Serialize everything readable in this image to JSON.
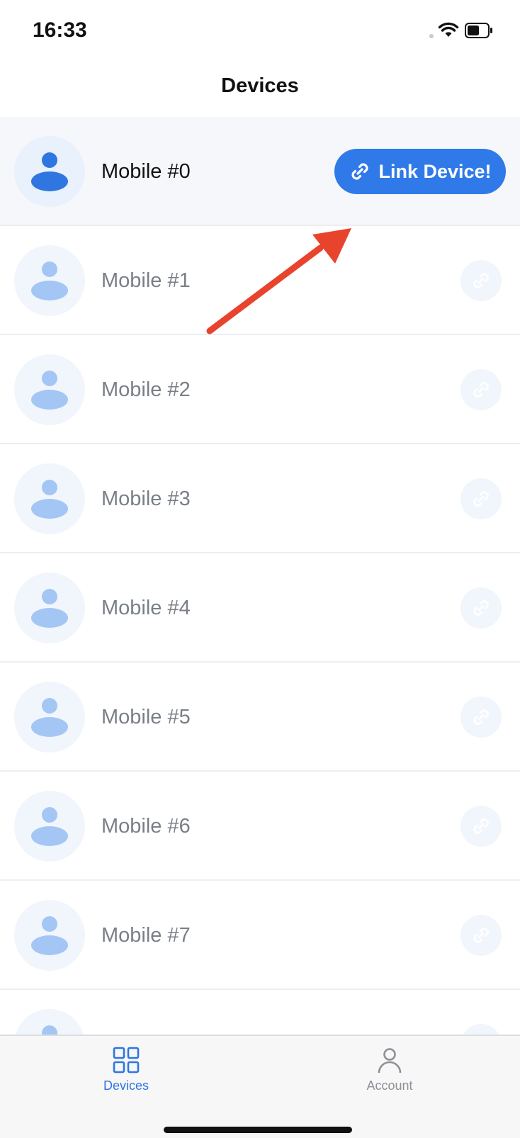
{
  "status_bar": {
    "time": "16:33",
    "icons": [
      "signal-dot-icon",
      "wifi-icon",
      "battery-icon"
    ]
  },
  "nav": {
    "title": "Devices"
  },
  "devices": [
    {
      "label": "Mobile #0",
      "selected": true,
      "action_label": "Link Device!"
    },
    {
      "label": "Mobile #1",
      "selected": false
    },
    {
      "label": "Mobile #2",
      "selected": false
    },
    {
      "label": "Mobile #3",
      "selected": false
    },
    {
      "label": "Mobile #4",
      "selected": false
    },
    {
      "label": "Mobile #5",
      "selected": false
    },
    {
      "label": "Mobile #6",
      "selected": false
    },
    {
      "label": "Mobile #7",
      "selected": false
    },
    {
      "label": "",
      "selected": false
    }
  ],
  "tab_bar": {
    "tabs": [
      {
        "label": "Devices",
        "icon": "grid-icon",
        "active": true
      },
      {
        "label": "Account",
        "icon": "person-icon",
        "active": false
      }
    ]
  },
  "colors": {
    "accent": "#2f7ae8",
    "annotation_arrow": "#e8432d",
    "muted_text": "#7a7f87"
  }
}
